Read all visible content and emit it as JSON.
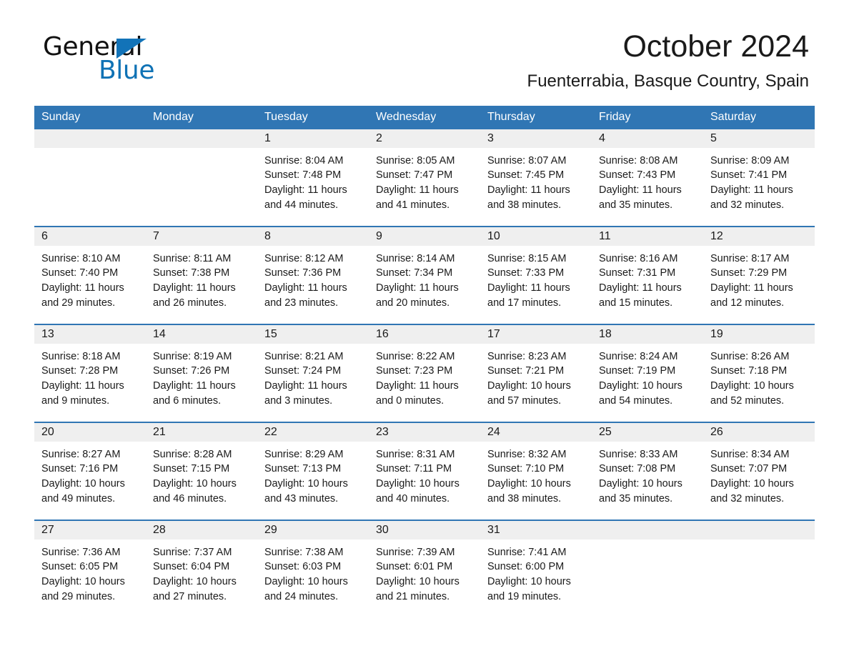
{
  "brand": {
    "name_first": "General",
    "name_second": "Blue",
    "accent_color": "#0f72b5",
    "triangle_icon": "triangle-icon"
  },
  "header": {
    "title": "October 2024",
    "subtitle": "Fuenterrabia, Basque Country, Spain",
    "header_band_color": "#3076b4",
    "daynum_band_color": "#efefef"
  },
  "calendar": {
    "weekday_headers": [
      "Sunday",
      "Monday",
      "Tuesday",
      "Wednesday",
      "Thursday",
      "Friday",
      "Saturday"
    ],
    "weeks": [
      [
        {
          "day": "",
          "lines": []
        },
        {
          "day": "",
          "lines": []
        },
        {
          "day": "1",
          "lines": [
            "Sunrise: 8:04 AM",
            "Sunset: 7:48 PM",
            "Daylight: 11 hours and 44 minutes."
          ]
        },
        {
          "day": "2",
          "lines": [
            "Sunrise: 8:05 AM",
            "Sunset: 7:47 PM",
            "Daylight: 11 hours and 41 minutes."
          ]
        },
        {
          "day": "3",
          "lines": [
            "Sunrise: 8:07 AM",
            "Sunset: 7:45 PM",
            "Daylight: 11 hours and 38 minutes."
          ]
        },
        {
          "day": "4",
          "lines": [
            "Sunrise: 8:08 AM",
            "Sunset: 7:43 PM",
            "Daylight: 11 hours and 35 minutes."
          ]
        },
        {
          "day": "5",
          "lines": [
            "Sunrise: 8:09 AM",
            "Sunset: 7:41 PM",
            "Daylight: 11 hours and 32 minutes."
          ]
        }
      ],
      [
        {
          "day": "6",
          "lines": [
            "Sunrise: 8:10 AM",
            "Sunset: 7:40 PM",
            "Daylight: 11 hours and 29 minutes."
          ]
        },
        {
          "day": "7",
          "lines": [
            "Sunrise: 8:11 AM",
            "Sunset: 7:38 PM",
            "Daylight: 11 hours and 26 minutes."
          ]
        },
        {
          "day": "8",
          "lines": [
            "Sunrise: 8:12 AM",
            "Sunset: 7:36 PM",
            "Daylight: 11 hours and 23 minutes."
          ]
        },
        {
          "day": "9",
          "lines": [
            "Sunrise: 8:14 AM",
            "Sunset: 7:34 PM",
            "Daylight: 11 hours and 20 minutes."
          ]
        },
        {
          "day": "10",
          "lines": [
            "Sunrise: 8:15 AM",
            "Sunset: 7:33 PM",
            "Daylight: 11 hours and 17 minutes."
          ]
        },
        {
          "day": "11",
          "lines": [
            "Sunrise: 8:16 AM",
            "Sunset: 7:31 PM",
            "Daylight: 11 hours and 15 minutes."
          ]
        },
        {
          "day": "12",
          "lines": [
            "Sunrise: 8:17 AM",
            "Sunset: 7:29 PM",
            "Daylight: 11 hours and 12 minutes."
          ]
        }
      ],
      [
        {
          "day": "13",
          "lines": [
            "Sunrise: 8:18 AM",
            "Sunset: 7:28 PM",
            "Daylight: 11 hours and 9 minutes."
          ]
        },
        {
          "day": "14",
          "lines": [
            "Sunrise: 8:19 AM",
            "Sunset: 7:26 PM",
            "Daylight: 11 hours and 6 minutes."
          ]
        },
        {
          "day": "15",
          "lines": [
            "Sunrise: 8:21 AM",
            "Sunset: 7:24 PM",
            "Daylight: 11 hours and 3 minutes."
          ]
        },
        {
          "day": "16",
          "lines": [
            "Sunrise: 8:22 AM",
            "Sunset: 7:23 PM",
            "Daylight: 11 hours and 0 minutes."
          ]
        },
        {
          "day": "17",
          "lines": [
            "Sunrise: 8:23 AM",
            "Sunset: 7:21 PM",
            "Daylight: 10 hours and 57 minutes."
          ]
        },
        {
          "day": "18",
          "lines": [
            "Sunrise: 8:24 AM",
            "Sunset: 7:19 PM",
            "Daylight: 10 hours and 54 minutes."
          ]
        },
        {
          "day": "19",
          "lines": [
            "Sunrise: 8:26 AM",
            "Sunset: 7:18 PM",
            "Daylight: 10 hours and 52 minutes."
          ]
        }
      ],
      [
        {
          "day": "20",
          "lines": [
            "Sunrise: 8:27 AM",
            "Sunset: 7:16 PM",
            "Daylight: 10 hours and 49 minutes."
          ]
        },
        {
          "day": "21",
          "lines": [
            "Sunrise: 8:28 AM",
            "Sunset: 7:15 PM",
            "Daylight: 10 hours and 46 minutes."
          ]
        },
        {
          "day": "22",
          "lines": [
            "Sunrise: 8:29 AM",
            "Sunset: 7:13 PM",
            "Daylight: 10 hours and 43 minutes."
          ]
        },
        {
          "day": "23",
          "lines": [
            "Sunrise: 8:31 AM",
            "Sunset: 7:11 PM",
            "Daylight: 10 hours and 40 minutes."
          ]
        },
        {
          "day": "24",
          "lines": [
            "Sunrise: 8:32 AM",
            "Sunset: 7:10 PM",
            "Daylight: 10 hours and 38 minutes."
          ]
        },
        {
          "day": "25",
          "lines": [
            "Sunrise: 8:33 AM",
            "Sunset: 7:08 PM",
            "Daylight: 10 hours and 35 minutes."
          ]
        },
        {
          "day": "26",
          "lines": [
            "Sunrise: 8:34 AM",
            "Sunset: 7:07 PM",
            "Daylight: 10 hours and 32 minutes."
          ]
        }
      ],
      [
        {
          "day": "27",
          "lines": [
            "Sunrise: 7:36 AM",
            "Sunset: 6:05 PM",
            "Daylight: 10 hours and 29 minutes."
          ]
        },
        {
          "day": "28",
          "lines": [
            "Sunrise: 7:37 AM",
            "Sunset: 6:04 PM",
            "Daylight: 10 hours and 27 minutes."
          ]
        },
        {
          "day": "29",
          "lines": [
            "Sunrise: 7:38 AM",
            "Sunset: 6:03 PM",
            "Daylight: 10 hours and 24 minutes."
          ]
        },
        {
          "day": "30",
          "lines": [
            "Sunrise: 7:39 AM",
            "Sunset: 6:01 PM",
            "Daylight: 10 hours and 21 minutes."
          ]
        },
        {
          "day": "31",
          "lines": [
            "Sunrise: 7:41 AM",
            "Sunset: 6:00 PM",
            "Daylight: 10 hours and 19 minutes."
          ]
        },
        {
          "day": "",
          "lines": []
        },
        {
          "day": "",
          "lines": []
        }
      ]
    ]
  }
}
